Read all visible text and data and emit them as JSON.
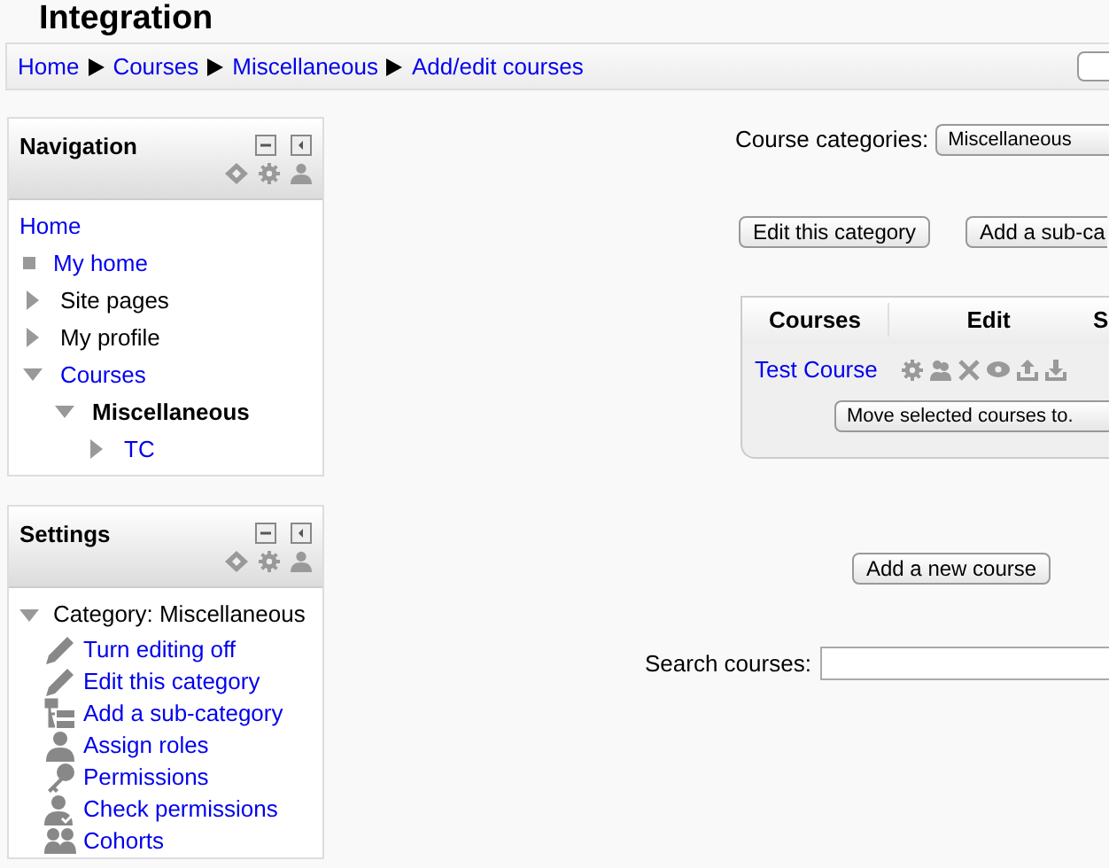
{
  "page_title": "Integration",
  "breadcrumb": [
    "Home",
    "Courses",
    "Miscellaneous",
    "Add/edit courses"
  ],
  "navigation": {
    "title": "Navigation",
    "items": [
      {
        "label": "Home",
        "kind": "plain",
        "link": true,
        "current": false
      },
      {
        "label": "My home",
        "kind": "leaf",
        "link": true,
        "current": false
      },
      {
        "label": "Site pages",
        "kind": "branch",
        "expanded": false,
        "link": false,
        "current": false
      },
      {
        "label": "My profile",
        "kind": "branch",
        "expanded": false,
        "link": false,
        "current": false
      },
      {
        "label": "Courses",
        "kind": "branch",
        "expanded": true,
        "link": true,
        "current": false,
        "children": [
          {
            "label": "Miscellaneous",
            "kind": "branch",
            "expanded": true,
            "link": false,
            "current": true,
            "children": [
              {
                "label": "TC",
                "kind": "branch",
                "expanded": false,
                "link": true,
                "current": false
              }
            ]
          }
        ]
      }
    ]
  },
  "settings": {
    "title": "Settings",
    "category": {
      "label": "Category: Miscellaneous",
      "expanded": true
    },
    "items": [
      {
        "label": "Turn editing off",
        "kind": "pencil"
      },
      {
        "label": "Edit this category",
        "kind": "pencil"
      },
      {
        "label": "Add a sub-category",
        "kind": "tree"
      },
      {
        "label": "Assign roles",
        "kind": "person"
      },
      {
        "label": "Permissions",
        "kind": "key"
      },
      {
        "label": "Check permissions",
        "kind": "person-check"
      },
      {
        "label": "Cohorts",
        "kind": "people"
      }
    ]
  },
  "category_select": {
    "label": "Course categories:",
    "value": "Miscellaneous"
  },
  "category_buttons": [
    "Edit this category",
    "Add a sub-ca"
  ],
  "table": {
    "columns": [
      "Courses",
      "Edit",
      "S"
    ],
    "rows": [
      {
        "course": "Test Course"
      }
    ],
    "move_button": "Move selected courses to."
  },
  "add_course_button": "Add a new course",
  "search": {
    "label": "Search courses:"
  }
}
